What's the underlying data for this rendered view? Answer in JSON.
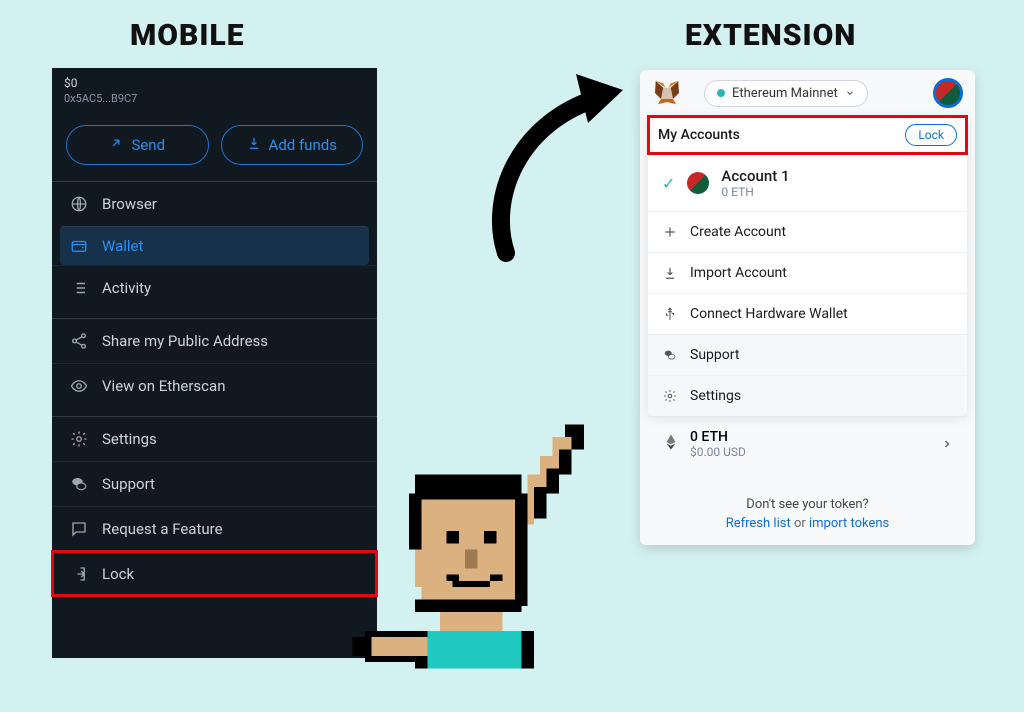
{
  "headings": {
    "mobile": "MOBILE",
    "extension": "EXTENSION"
  },
  "mobile": {
    "balance": "$0",
    "address": "0x5AC5...B9C7",
    "send_label": "Send",
    "add_funds_label": "Add funds",
    "items": {
      "browser": "Browser",
      "wallet": "Wallet",
      "activity": "Activity",
      "share": "Share my Public Address",
      "etherscan": "View on Etherscan",
      "settings": "Settings",
      "support": "Support",
      "request": "Request a Feature",
      "lock": "Lock"
    }
  },
  "extension": {
    "network": "Ethereum Mainnet",
    "menu_title": "My Accounts",
    "lock_label": "Lock",
    "account": {
      "name": "Account 1",
      "balance": "0 ETH"
    },
    "create": "Create Account",
    "import": "Import Account",
    "hardware": "Connect Hardware Wallet",
    "support": "Support",
    "settings": "Settings",
    "eth_balance": "0 ETH",
    "usd_balance": "$0.00 USD",
    "footer_q": "Don't see your token?",
    "refresh": "Refresh list",
    "or": "or",
    "import_tokens": "import tokens"
  }
}
